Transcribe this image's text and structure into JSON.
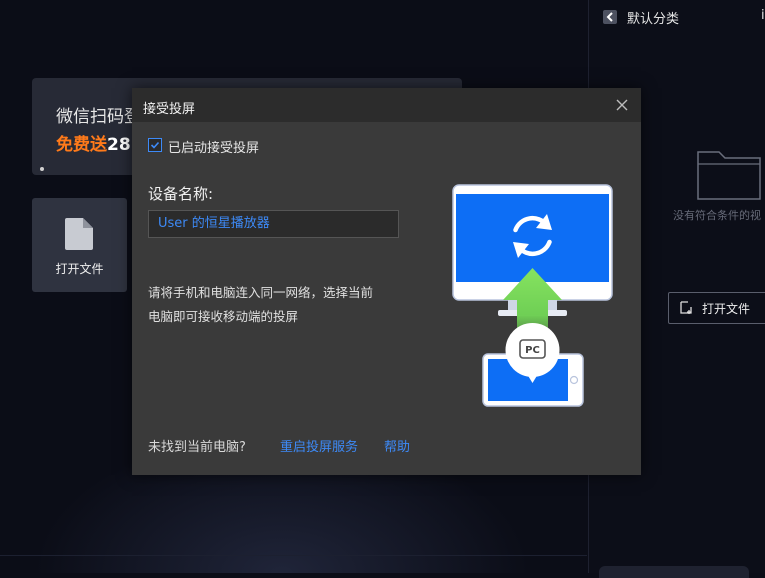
{
  "main": {
    "banner": {
      "title": "微信扫码登",
      "promo": "免费送",
      "promo_number": "28"
    },
    "open_file_tile": {
      "label": "打开文件"
    }
  },
  "right_panel": {
    "category_title": "默认分类",
    "extra_glyph": "i",
    "empty_text": "没有符合条件的视",
    "open_file_button": "打开文件"
  },
  "dialog": {
    "title": "接受投屏",
    "checkbox_label": "已启动接受投屏",
    "checkbox_checked": true,
    "device_name_label": "设备名称:",
    "device_name_value": "User 的恒星播放器",
    "instructions_line1": "请将手机和电脑连入同一网络，选择当前",
    "instructions_line2": "电脑即可接收移动端的投屏",
    "illustration_badge": "PC",
    "footer_question": "未找到当前电脑?",
    "restart_link": "重启投屏服务",
    "help_link": "帮助"
  },
  "colors": {
    "accent": "#3d8af7",
    "screen_blue": "#0d6ef5",
    "arrow_green": "#7bdb5c",
    "promo_orange": "#ff7a1a"
  },
  "icons": [
    "file-icon",
    "chevron-left-icon",
    "folder-icon",
    "close-icon",
    "check-icon",
    "sync-icon"
  ]
}
